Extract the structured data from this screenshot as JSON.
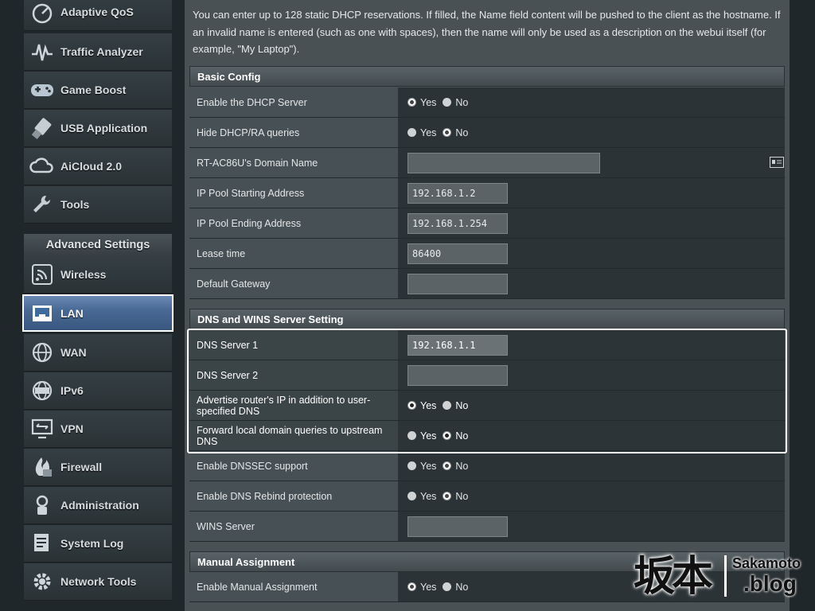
{
  "sidebar": {
    "items_top": [
      {
        "label": "Adaptive QoS",
        "icon": "qos-icon"
      },
      {
        "label": "Traffic Analyzer",
        "icon": "traffic-icon"
      },
      {
        "label": "Game Boost",
        "icon": "gamepad-icon"
      },
      {
        "label": "USB Application",
        "icon": "usb-icon"
      },
      {
        "label": "AiCloud 2.0",
        "icon": "cloud-icon"
      },
      {
        "label": "Tools",
        "icon": "wrench-icon"
      }
    ],
    "advanced_header": "Advanced Settings",
    "items_adv": [
      {
        "label": "Wireless",
        "icon": "wireless-icon"
      },
      {
        "label": "LAN",
        "icon": "lan-icon"
      },
      {
        "label": "WAN",
        "icon": "globe-icon"
      },
      {
        "label": "IPv6",
        "icon": "ipv6-icon"
      },
      {
        "label": "VPN",
        "icon": "vpn-icon"
      },
      {
        "label": "Firewall",
        "icon": "firewall-icon"
      },
      {
        "label": "Administration",
        "icon": "admin-icon"
      },
      {
        "label": "System Log",
        "icon": "log-icon"
      },
      {
        "label": "Network Tools",
        "icon": "gear-icon"
      }
    ],
    "active": "LAN"
  },
  "description": "You can enter up to 128 static DHCP reservations. If filled, the Name field content will be pushed to the client as the hostname. If an invalid name is entered (such as one with spaces), then the name will only be used as a description on the webui itself (for example, \"My Laptop\").",
  "basic": {
    "title": "Basic Config",
    "enable_dhcp": {
      "label": "Enable the DHCP Server",
      "yes": "Yes",
      "no": "No",
      "selected": "yes"
    },
    "hide_dhcp": {
      "label": "Hide DHCP/RA queries",
      "yes": "Yes",
      "no": "No",
      "selected": "no"
    },
    "domain_name": {
      "label": "RT-AC86U's Domain Name",
      "value": ""
    },
    "pool_start": {
      "label": "IP Pool Starting Address",
      "value": "192.168.1.2"
    },
    "pool_end": {
      "label": "IP Pool Ending Address",
      "value": "192.168.1.254"
    },
    "lease_time": {
      "label": "Lease time",
      "value": "86400"
    },
    "gateway": {
      "label": "Default Gateway",
      "value": ""
    }
  },
  "dns": {
    "title": "DNS and WINS Server Setting",
    "dns1": {
      "label": "DNS Server 1",
      "value": "192.168.1.1"
    },
    "dns2": {
      "label": "DNS Server 2",
      "value": ""
    },
    "advertise": {
      "label": "Advertise router's IP in addition to user-specified DNS",
      "yes": "Yes",
      "no": "No",
      "selected": "yes"
    },
    "forward": {
      "label": "Forward local domain queries to upstream DNS",
      "yes": "Yes",
      "no": "No",
      "selected": "no"
    },
    "dnssec": {
      "label": "Enable DNSSEC support",
      "yes": "Yes",
      "no": "No",
      "selected": "no"
    },
    "rebind": {
      "label": "Enable DNS Rebind protection",
      "yes": "Yes",
      "no": "No",
      "selected": "no"
    },
    "wins": {
      "label": "WINS Server",
      "value": ""
    }
  },
  "manual": {
    "title": "Manual Assignment",
    "enable_manual": {
      "label": "Enable Manual Assignment",
      "yes": "Yes",
      "no": "No",
      "selected": "yes"
    }
  },
  "watermark": {
    "kanji": "坂本",
    "brand": "Sakamoto",
    "blog": ".blog"
  }
}
